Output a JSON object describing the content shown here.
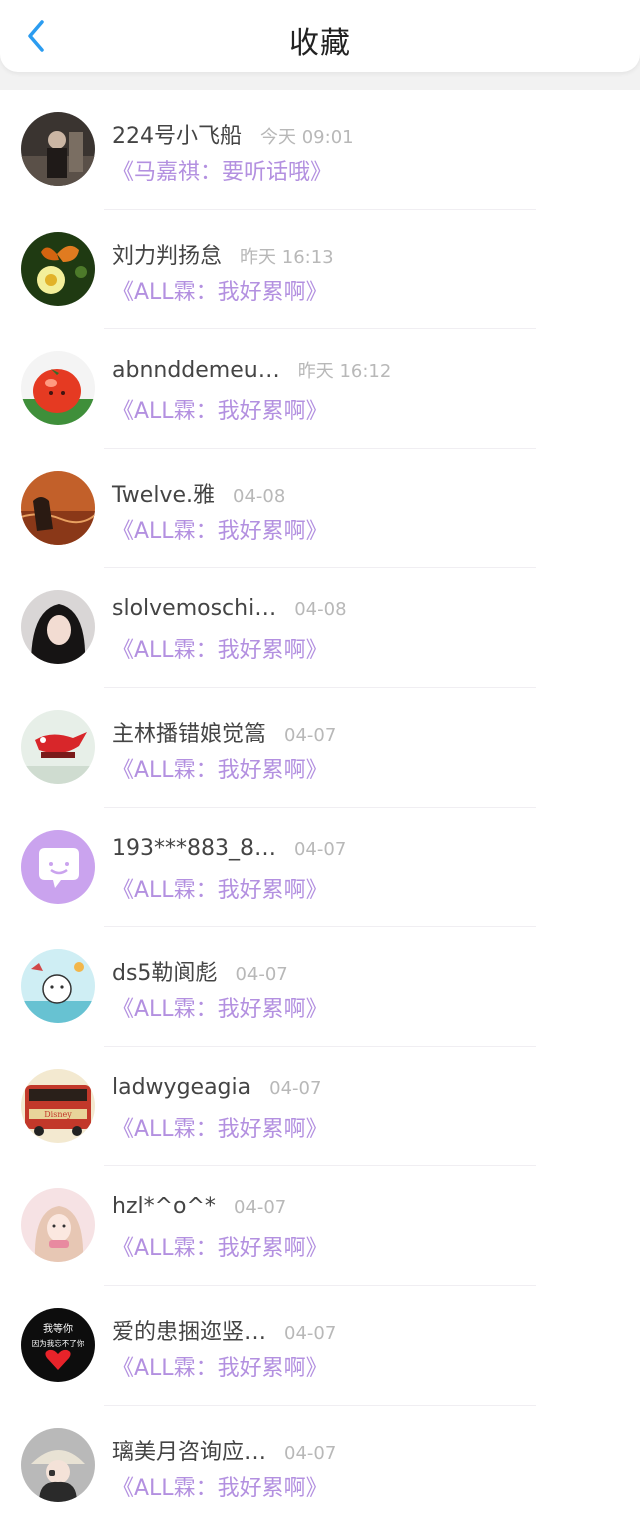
{
  "header": {
    "title": "收藏"
  },
  "items": [
    {
      "name": "224号小飞船",
      "time": "今天 09:01",
      "message": "《马嘉祺：要听话哦》",
      "avatar": "dark-portrait"
    },
    {
      "name": "刘力判扬怠",
      "time": "昨天 16:13",
      "message": "《ALL霖：我好累啊》",
      "avatar": "butterfly-flower"
    },
    {
      "name": "abnnddemeu…",
      "time": "昨天 16:12",
      "message": "《ALL霖：我好累啊》",
      "avatar": "tomato"
    },
    {
      "name": "Twelve.雅",
      "time": "04-08",
      "message": "《ALL霖：我好累啊》",
      "avatar": "sunset-silhouette"
    },
    {
      "name": "slolvemoschi…",
      "time": "04-08",
      "message": "《ALL霖：我好累啊》",
      "avatar": "girl-dark-hair"
    },
    {
      "name": "主林播错娘觉篙",
      "time": "04-07",
      "message": "《ALL霖：我好累啊》",
      "avatar": "red-bird"
    },
    {
      "name": "193***883_8…",
      "time": "04-07",
      "message": "《ALL霖：我好累啊》",
      "avatar": "chat-bubble"
    },
    {
      "name": "ds5勒阆彪",
      "time": "04-07",
      "message": "《ALL霖：我好累啊》",
      "avatar": "cartoon-cat"
    },
    {
      "name": "ladwygeagia",
      "time": "04-07",
      "message": "《ALL霖：我好累啊》",
      "avatar": "disney-bus"
    },
    {
      "name": "hzl*^o^*",
      "time": "04-07",
      "message": "《ALL霖：我好累啊》",
      "avatar": "pink-girl"
    },
    {
      "name": "爱的患捆迩竖…",
      "time": "04-07",
      "message": "《ALL霖：我好累啊》",
      "avatar": "black-heart",
      "avatar_text": [
        "我等你",
        "因为我忘不了你"
      ]
    },
    {
      "name": "璃美月咨询应…",
      "time": "04-07",
      "message": "《ALL霖：我好累啊》",
      "avatar": "girl-hat"
    }
  ],
  "colors": {
    "accent": "#2b9cf0",
    "message": "#b390e0",
    "time": "#b8b8b8",
    "name": "#444444"
  }
}
